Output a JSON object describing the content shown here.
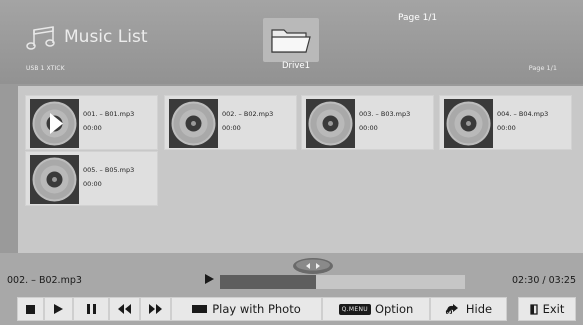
{
  "header": {
    "title": "Music List",
    "source": "USB 1 XTICK",
    "page_top": "Page 1/1",
    "page_right": "Page 1/1",
    "folder_label": "Drive1"
  },
  "files": [
    {
      "name": "001. – B01.mp3",
      "duration": "00:00",
      "playing": true
    },
    {
      "name": "002. – B02.mp3",
      "duration": "00:00",
      "playing": false
    },
    {
      "name": "003. – B03.mp3",
      "duration": "00:00",
      "playing": false
    },
    {
      "name": "004. – B04.mp3",
      "duration": "00:00",
      "playing": false
    },
    {
      "name": "005. – B05.mp3",
      "duration": "00:00",
      "playing": false
    }
  ],
  "player": {
    "current_file": "002. – B02.mp3",
    "time": "02:30 / 03:25",
    "progress": 0.39
  },
  "controls": {
    "play_with_photo": "Play with Photo",
    "qmenu_key": "Q.MENU",
    "option": "Option",
    "hide": "Hide",
    "exit": "Exit"
  }
}
